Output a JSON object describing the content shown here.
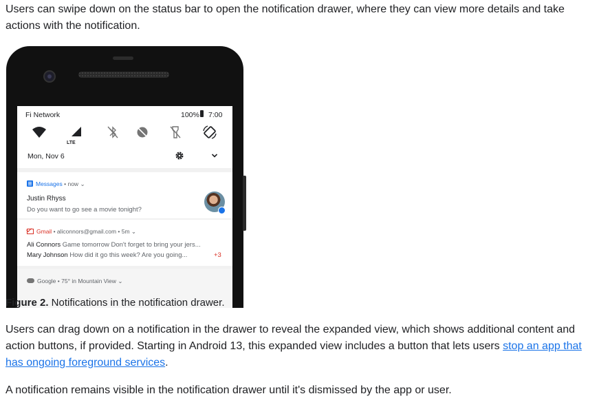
{
  "intro": "Users can swipe down on the status bar to open the notification drawer, where they can view more details and take actions with the notification.",
  "phone": {
    "status": {
      "carrier": "Fi Network",
      "battery": "100%",
      "time": "7:00"
    },
    "lte_label": "LTE",
    "icons": [
      "wifi-icon",
      "cellular-signal-icon",
      "bluetooth-off-icon",
      "do-not-disturb-icon",
      "flashlight-off-icon",
      "auto-rotate-icon",
      "settings-gear-icon",
      "expand-chevron-icon"
    ],
    "date": "Mon, Nov 6",
    "notifications": [
      {
        "app": "Messages",
        "meta": "• now",
        "sender": "Justin Rhyss",
        "body": "Do you want to go see a movie tonight?"
      },
      {
        "app": "Gmail",
        "meta": "• aliconnors@gmail.com • 5m",
        "lines": [
          {
            "name": "Ali Connors",
            "text": "Game tomorrow Don't forget to bring your jers..."
          },
          {
            "name": "Mary Johnson",
            "text": "How did it go this week? Are you going..."
          }
        ],
        "more": "+3"
      },
      {
        "app": "Google",
        "meta": "• 75° in Mountain View"
      }
    ],
    "colors": {
      "accent": "#1a73e8",
      "gmail": "#d93025"
    }
  },
  "caption": {
    "label": "Figure 2.",
    "text": " Notifications in the notification drawer."
  },
  "para2": {
    "before": "Users can drag down on a notification in the drawer to reveal the expanded view, which shows additional content and action buttons, if provided. Starting in Android 13, this expanded view includes a button that lets users ",
    "link": "stop an app that has ongoing foreground services",
    "after": "."
  },
  "para3": "A notification remains visible in the notification drawer until it's dismissed by the app or user."
}
